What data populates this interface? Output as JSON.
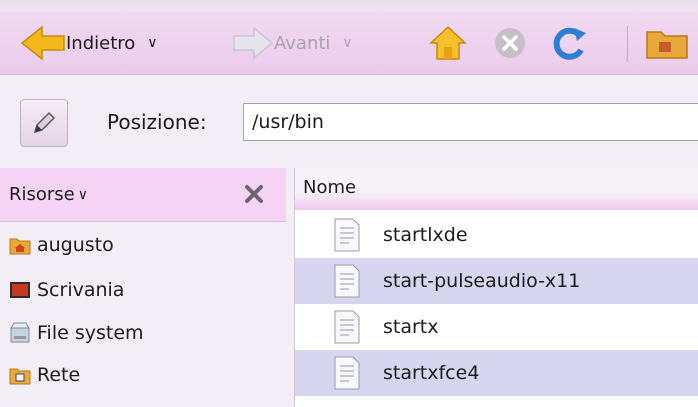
{
  "toolbar": {
    "back_label": "Indietro",
    "forward_label": "Avanti"
  },
  "location": {
    "label": "Posizione:",
    "path": "/usr/bin"
  },
  "sidebar": {
    "title": "Risorse",
    "items": [
      {
        "label": "augusto",
        "icon": "home-folder-icon"
      },
      {
        "label": "Scrivania",
        "icon": "desktop-icon"
      },
      {
        "label": "File system",
        "icon": "drive-icon"
      },
      {
        "label": "Rete",
        "icon": "network-icon"
      }
    ]
  },
  "files": {
    "column_name": "Nome",
    "rows": [
      {
        "name": "startlxde"
      },
      {
        "name": "start-pulseaudio-x11"
      },
      {
        "name": "startx"
      },
      {
        "name": "startxfce4"
      }
    ]
  },
  "colors": {
    "toolbar_bg": "#ebcbec",
    "row_alt": "#d8d5f0",
    "header_bg": "#f5d3f5"
  }
}
